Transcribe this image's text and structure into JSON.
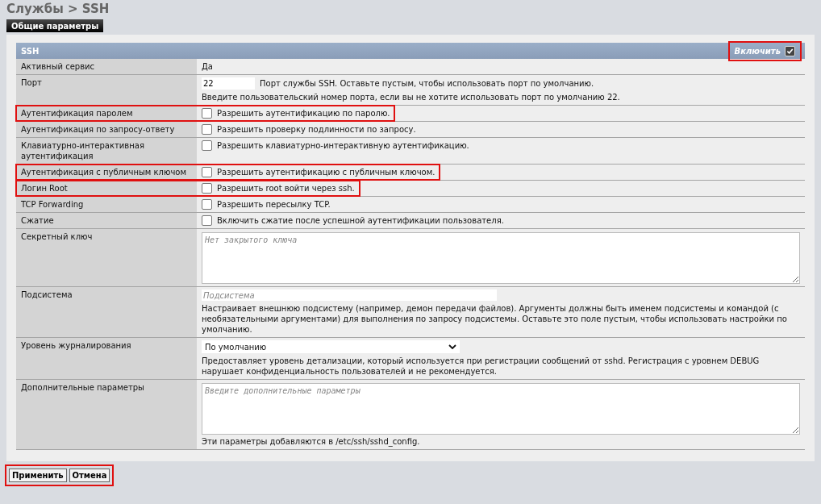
{
  "breadcrumb": "Службы > SSH",
  "tabs": [
    {
      "label": "Общие параметры",
      "selected": true
    }
  ],
  "section": {
    "title": "SSH",
    "enable": {
      "label": "Включить",
      "checked": true,
      "highlighted": true
    }
  },
  "rows": [
    {
      "kind": "text",
      "label": "Активный сервис",
      "value": "Да",
      "highlighted": false
    },
    {
      "kind": "port",
      "label": "Порт",
      "value": "22",
      "hint": "Порт службы SSH. Оставьте пустым, чтобы использовать порт по умолчанию.",
      "description": "Введите пользовательский номер порта, если вы не хотите использовать порт по умолчанию 22.",
      "highlighted": false
    },
    {
      "kind": "checkbox",
      "label": "Аутентификация паролем",
      "text": "Разрешить аутентификацию по паролю.",
      "checked": false,
      "highlighted": true
    },
    {
      "kind": "checkbox",
      "label": "Аутентификация по запросу-ответу",
      "text": "Разрешить проверку подлинности по запросу.",
      "checked": false,
      "highlighted": false
    },
    {
      "kind": "checkbox",
      "label": "Клавиатурно-интерактивная аутентификация",
      "text": "Разрешить клавиатурно-интерактивную аутентификацию.",
      "checked": false,
      "highlighted": false
    },
    {
      "kind": "checkbox",
      "label": "Аутентификация с публичным ключом",
      "text": "Разрешить аутентификацию с публичным ключом.",
      "checked": false,
      "highlighted": true
    },
    {
      "kind": "checkbox",
      "label": "Логин Root",
      "text": "Разрешить root войти через ssh.",
      "checked": false,
      "highlighted": true
    },
    {
      "kind": "checkbox",
      "label": "TCP Forwarding",
      "text": "Разрешить пересылку TCP.",
      "checked": false,
      "highlighted": false
    },
    {
      "kind": "checkbox",
      "label": "Сжатие",
      "text": "Включить сжатие после успешной аутентификации пользователя.",
      "checked": false,
      "highlighted": false
    },
    {
      "kind": "textarea",
      "label": "Секретный ключ",
      "placeholder": "Нет закрытого ключа",
      "highlighted": false
    },
    {
      "kind": "input",
      "label": "Подсистема",
      "placeholder": "Подсистема",
      "description": "Настраивает внешнюю подсистему (например, демон передачи файлов). Аргументы должны быть именем подсистемы и командой (с необязательными аргументами) для выполнения по запросу подсистемы. Оставьте это поле пустым, чтобы использовать настройки по умолчанию.",
      "highlighted": false
    },
    {
      "kind": "select",
      "label": "Уровень журналирования",
      "value": "По умолчанию",
      "description": "Предоставляет уровень детализации, который используется при регистрации сообщений от sshd. Регистрация с уровнем DEBUG нарушает конфиденциальность пользователей и не рекомендуется.",
      "highlighted": false
    },
    {
      "kind": "textarea",
      "label": "Дополнительные параметры",
      "placeholder": "Введите дополнительные параметры",
      "description": "Эти параметры добавляются в /etc/ssh/sshd_config.",
      "highlighted": false
    }
  ],
  "buttons": [
    {
      "label": "Применить"
    },
    {
      "label": "Отмена"
    }
  ],
  "buttons_highlighted": true
}
